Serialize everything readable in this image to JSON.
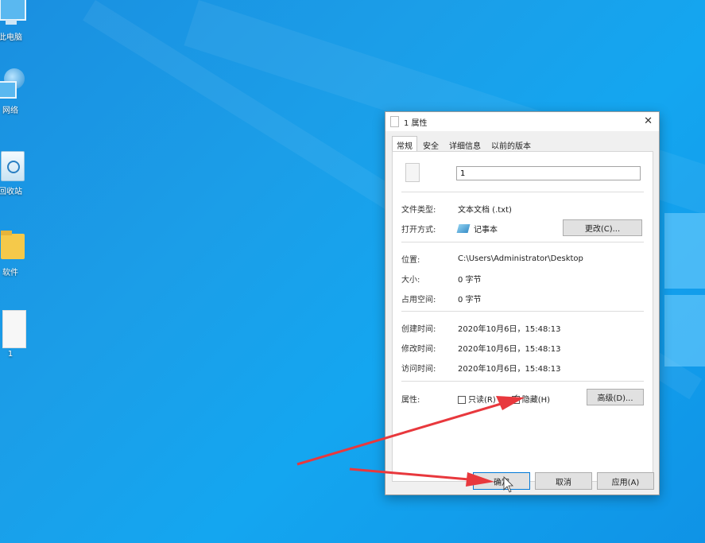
{
  "desktop": {
    "icons": [
      {
        "label": "此电脑",
        "icon": "computer-icon"
      },
      {
        "label": "网络",
        "icon": "network-icon"
      },
      {
        "label": "回收站",
        "icon": "recycle-bin-icon"
      },
      {
        "label": "软件",
        "icon": "folder-icon"
      },
      {
        "label": "1",
        "icon": "text-file-icon"
      }
    ]
  },
  "dialog": {
    "title": "1 属性",
    "close": "✕",
    "tabs": [
      "常规",
      "安全",
      "详细信息",
      "以前的版本"
    ],
    "filename": "1",
    "file_type_label": "文件类型:",
    "file_type_value": "文本文档 (.txt)",
    "open_with_label": "打开方式:",
    "open_with_value": "记事本",
    "change_button": "更改(C)...",
    "location_label": "位置:",
    "location_value": "C:\\Users\\Administrator\\Desktop",
    "size_label": "大小:",
    "size_value": "0 字节",
    "disk_size_label": "占用空间:",
    "disk_size_value": "0 字节",
    "created_label": "创建时间:",
    "created_value": "2020年10月6日，15:48:13",
    "modified_label": "修改时间:",
    "modified_value": "2020年10月6日，15:48:13",
    "accessed_label": "访问时间:",
    "accessed_value": "2020年10月6日，15:48:13",
    "attributes_label": "属性:",
    "readonly_label": "只读(R)",
    "readonly_checked": false,
    "hidden_label": "隐藏(H)",
    "hidden_checked": true,
    "advanced_button": "高级(D)...",
    "ok_button": "确定",
    "cancel_button": "取消",
    "apply_button": "应用(A)"
  },
  "colors": {
    "arrow": "#e8383d",
    "accent": "#0078d7"
  }
}
